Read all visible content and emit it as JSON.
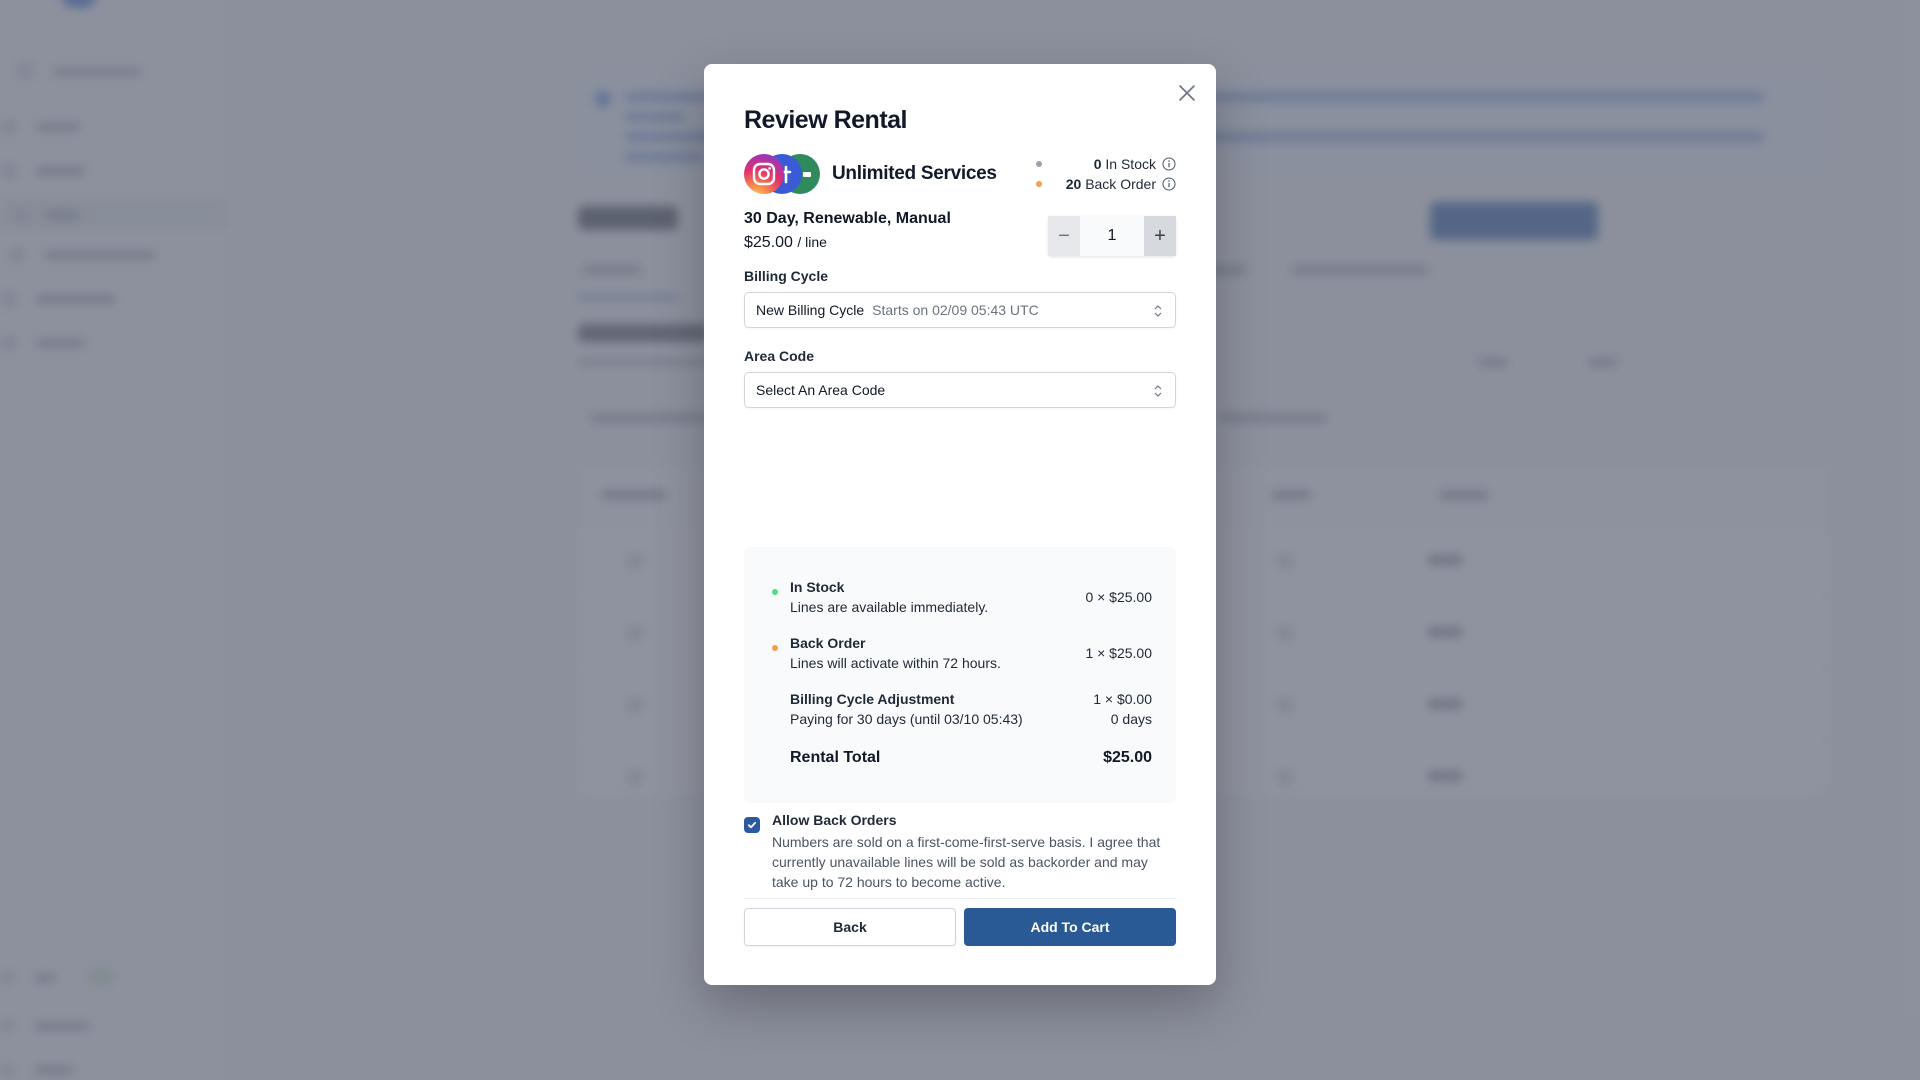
{
  "modal": {
    "title": "Review Rental",
    "close_label": "Close",
    "service": {
      "name": "Unlimited Services",
      "icons": [
        "instagram-icon",
        "facebook-icon",
        "google-voice-icon"
      ]
    },
    "stock": {
      "in_stock_count": "0",
      "in_stock_label": "In Stock",
      "back_order_count": "20",
      "back_order_label": "Back Order"
    },
    "plan": {
      "name": "30 Day, Renewable, Manual",
      "price": "$25.00",
      "price_unit": "/ line"
    },
    "quantity": {
      "value": "1",
      "decrement": "−",
      "increment": "+"
    },
    "billing_cycle": {
      "label": "Billing Cycle",
      "value": "New Billing Cycle",
      "hint": "Starts on 02/09 05:43 UTC"
    },
    "area_code": {
      "label": "Area Code",
      "placeholder": "Select An Area Code"
    },
    "summary": {
      "rows": [
        {
          "title": "In Stock",
          "desc": "Lines are available immediately.",
          "amount": "0 ×  $25.00",
          "amount2": ""
        },
        {
          "title": "Back Order",
          "desc": "Lines will activate within 72 hours.",
          "amount": "1 ×  $25.00",
          "amount2": ""
        },
        {
          "title": "Billing Cycle Adjustment",
          "desc": "Paying for 30 days (until 03/10 05:43)",
          "amount": "1 ×  $0.00",
          "amount2": "0 days"
        }
      ],
      "total_label": "Rental Total",
      "total_amount": "$25.00"
    },
    "consent": {
      "checked": true,
      "title": "Allow Back Orders",
      "text": "Numbers are sold on a first-come-first-serve basis. I agree that currently unavailable lines will be sold as backorder and may take up to 72 hours to become active."
    },
    "buttons": {
      "back": "Back",
      "add_to_cart": "Add To Cart"
    }
  },
  "colors": {
    "primary": "#2a5a96",
    "in_stock_dot": "#9ca3af",
    "back_order_dot": "#f59e4b",
    "summary_in_stock_dot": "#4ade80",
    "overlay": "#646a7a"
  }
}
